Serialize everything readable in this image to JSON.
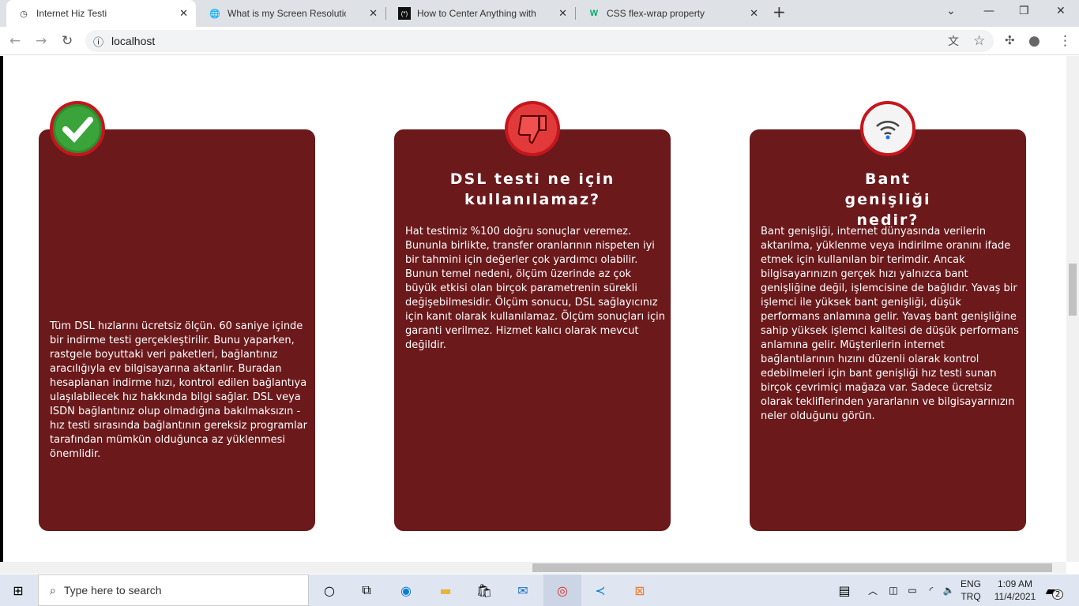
{
  "browser": {
    "tabs": [
      {
        "title": "Internet Hiz Testi",
        "icon": "clock-icon",
        "active": true
      },
      {
        "title": "What is my Screen Resolution: Fin",
        "icon": "globe-icon"
      },
      {
        "title": "How to Center Anything with CSS",
        "icon": "css-tricks-icon"
      },
      {
        "title": "CSS flex-wrap property",
        "icon": "w3schools-icon"
      }
    ],
    "url": "localhost"
  },
  "cards": [
    {
      "icon": "checkmark-icon",
      "title": "",
      "text": "Tüm DSL hızlarını ücretsiz ölçün. 60 saniye içinde bir indirme testi gerçekleştirilir. Bunu yaparken, rastgele boyuttaki veri paketleri, bağlantınız aracılığıyla ev bilgisayarına aktarılır. Buradan hesaplanan indirme hızı, kontrol edilen bağlantıya ulaşılabilecek hız hakkında bilgi sağlar. DSL veya ISDN bağlantınız olup olmadığına bakılmaksızın - hız testi sırasında bağlantının gereksiz programlar tarafından mümkün olduğunca az yüklenmesi önemlidir."
    },
    {
      "icon": "thumbs-down-icon",
      "title": "DSL testi ne için kullanılamaz?",
      "text": "Hat testimiz %100 doğru sonuçlar veremez. Bununla birlikte, transfer oranlarının nispeten iyi bir tahmini için değerler çok yardımcı olabilir. Bunun temel nedeni, ölçüm üzerinde az çok büyük etkisi olan birçok parametrenin sürekli değişebilmesidir. Ölçüm sonucu, DSL sağlayıcınız için kanıt olarak kullanılamaz. Ölçüm sonuçları için garanti verilmez. Hizmet kalıcı olarak mevcut değildir."
    },
    {
      "icon": "wifi-icon",
      "title": "Bant genişliği nedir?",
      "text": "Bant genişliği, internet dünyasında verilerin aktarılma, yüklenme veya indirilme oranını ifade etmek için kullanılan bir terimdir. Ancak bilgisayarınızın gerçek hızı yalnızca bant genişliğine değil, işlemcisine de bağlıdır. Yavaş bir işlemci ile yüksek bant genişliği, düşük performans anlamına gelir. Yavaş bant genişliğine sahip yüksek işlemci kalitesi de düşük performans anlamına gelir. Müşterilerin internet bağlantılarının hızını düzenli olarak kontrol edebilmeleri için bant genişliği hız testi sunan birçok çevrimiçi mağaza var. Sadece ücretsiz olarak tekliflerinden yararlanın ve bilgisayarınızın neler olduğunu görün."
    }
  ],
  "taskbar": {
    "search_placeholder": "Type here to search",
    "lang1": "ENG",
    "lang2": "TRQ",
    "time": "1:09 AM",
    "date": "11/4/2021",
    "notifications": "2"
  },
  "colors": {
    "card": "#6b191b",
    "badge_ring": "#c4161c"
  }
}
